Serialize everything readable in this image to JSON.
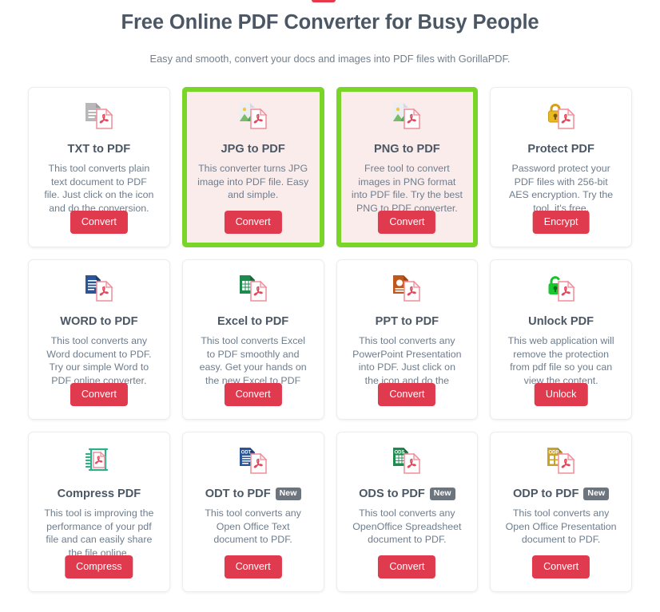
{
  "header": {
    "title": "Free Online PDF Converter for Busy People",
    "subtitle": "Easy and smooth, convert your docs and images into PDF files with GorillaPDF."
  },
  "colors": {
    "accent_red": "#e03a4e",
    "highlight_green": "#79d629",
    "selected_card_bg": "#fbecec",
    "title_text": "#4c5765",
    "body_text": "#6e7d8d",
    "badge_gray": "#6c757d"
  },
  "cards": [
    {
      "title": "TXT to PDF",
      "badge": null,
      "description": "This tool converts plain text document to PDF file. Just click on the icon and do the conversion.",
      "button": "Convert",
      "icon": "txt-to-pdf-icon",
      "selected": false
    },
    {
      "title": "JPG to PDF",
      "badge": null,
      "description": "This converter turns JPG image into PDF file. Easy and simple.",
      "button": "Convert",
      "icon": "jpg-to-pdf-icon",
      "selected": true
    },
    {
      "title": "PNG to PDF",
      "badge": null,
      "description": "Free tool to convert images in PNG format into PDF file. Try the best PNG to PDF converter.",
      "button": "Convert",
      "icon": "png-to-pdf-icon",
      "selected": true
    },
    {
      "title": "Protect PDF",
      "badge": null,
      "description": "Password protect your PDF files with 256-bit AES encryption. Try the tool, it's free.",
      "button": "Encrypt",
      "icon": "protect-pdf-lock-icon",
      "selected": false
    },
    {
      "title": "WORD to PDF",
      "badge": null,
      "description": "This tool converts any Word document to PDF. Try our simple Word to PDF online converter.",
      "button": "Convert",
      "icon": "word-to-pdf-icon",
      "selected": false
    },
    {
      "title": "Excel to PDF",
      "badge": null,
      "description": "This tool converts Excel to PDF smoothly and easy. Get your hands on the new Excel to PDF tool.",
      "button": "Convert",
      "icon": "excel-to-pdf-icon",
      "selected": false
    },
    {
      "title": "PPT to PDF",
      "badge": null,
      "description": "This tool converts any PowerPoint Presentation into PDF. Just click on the icon and do the conversion.",
      "button": "Convert",
      "icon": "ppt-to-pdf-icon",
      "selected": false
    },
    {
      "title": "Unlock PDF",
      "badge": null,
      "description": "This web application will remove the protection from pdf file so you can view the content.",
      "button": "Unlock",
      "icon": "unlock-pdf-icon",
      "selected": false
    },
    {
      "title": "Compress PDF",
      "badge": null,
      "description": "This tool is improving the performance of your pdf file and can easily share the file online.",
      "button": "Compress",
      "icon": "compress-pdf-icon",
      "selected": false
    },
    {
      "title": "ODT to PDF",
      "badge": "New",
      "description": "This tool converts any Open Office Text document to PDF.",
      "button": "Convert",
      "icon": "odt-to-pdf-icon",
      "selected": false
    },
    {
      "title": "ODS to PDF",
      "badge": "New",
      "description": "This tool converts any OpenOffice Spreadsheet document to PDF.",
      "button": "Convert",
      "icon": "ods-to-pdf-icon",
      "selected": false
    },
    {
      "title": "ODP to PDF",
      "badge": "New",
      "description": "This tool converts any Open Office Presentation document to PDF.",
      "button": "Convert",
      "icon": "odp-to-pdf-icon",
      "selected": false
    }
  ]
}
